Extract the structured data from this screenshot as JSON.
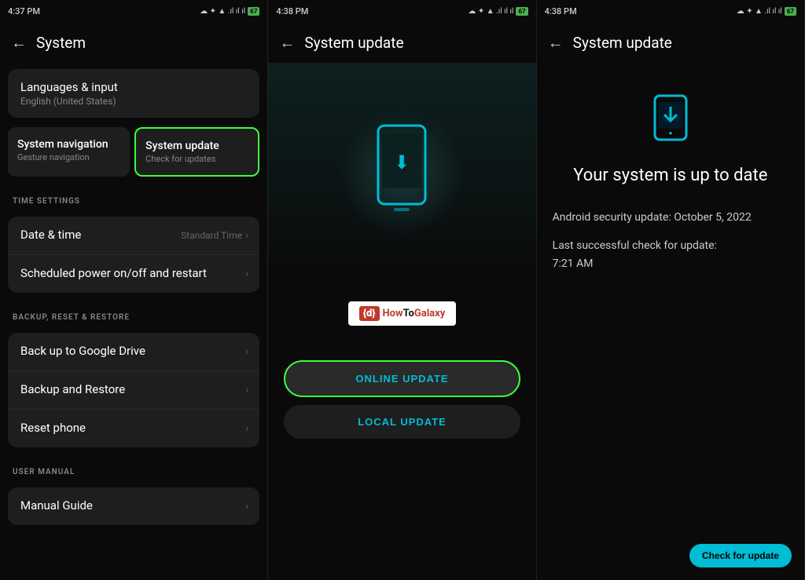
{
  "panel1": {
    "statusTime": "4:37 PM",
    "statusIcons": "☁ ✦ ▲ .ıl ıl ıl",
    "batteryLevel": "67",
    "backLabel": "←",
    "title": "System",
    "cards": {
      "topGroup": [
        {
          "title": "Languages & input",
          "sub": "English (United States)",
          "highlighted": false
        }
      ],
      "navGroup": [
        {
          "title": "System navigation",
          "sub": "Gesture navigation",
          "highlighted": false
        },
        {
          "title": "System update",
          "sub": "Check for updates",
          "highlighted": true
        }
      ],
      "timeSection": "TIME SETTINGS",
      "timeItems": [
        {
          "title": "Date & time",
          "rightText": "Standard Time",
          "rightChevron": "›"
        },
        {
          "title": "Scheduled power on/off and restart",
          "rightText": "",
          "rightChevron": "›"
        }
      ],
      "backupSection": "BACKUP, RESET & RESTORE",
      "backupItems": [
        {
          "title": "Back up to Google Drive",
          "rightChevron": "›"
        },
        {
          "title": "Backup and Restore",
          "rightChevron": "›"
        },
        {
          "title": "Reset phone",
          "rightChevron": "›"
        }
      ],
      "manualSection": "USER MANUAL",
      "manualItems": [
        {
          "title": "Manual Guide",
          "rightChevron": "›"
        }
      ]
    }
  },
  "panel2": {
    "statusTime": "4:38 PM",
    "statusIcons": "☁ ✦ ▲ .ıl ıl ıl",
    "batteryLevel": "67",
    "backLabel": "←",
    "title": "System update",
    "logo": {
      "prefix": "{d}",
      "text": "HowToGalaxy"
    },
    "buttons": {
      "online": "ONLINE UPDATE",
      "local": "LOCAL UPDATE"
    }
  },
  "panel3": {
    "statusTime": "4:38 PM",
    "statusIcons": "☁ ✦ ▲ .ıl ıl ıl",
    "batteryLevel": "67",
    "backLabel": "←",
    "title": "System update",
    "mainTitle": "Your system is up to date",
    "info1": "Android security update: October 5, 2022",
    "info2": "Last successful check for update:\n7:21 AM",
    "checkBtn": "Check for update"
  }
}
